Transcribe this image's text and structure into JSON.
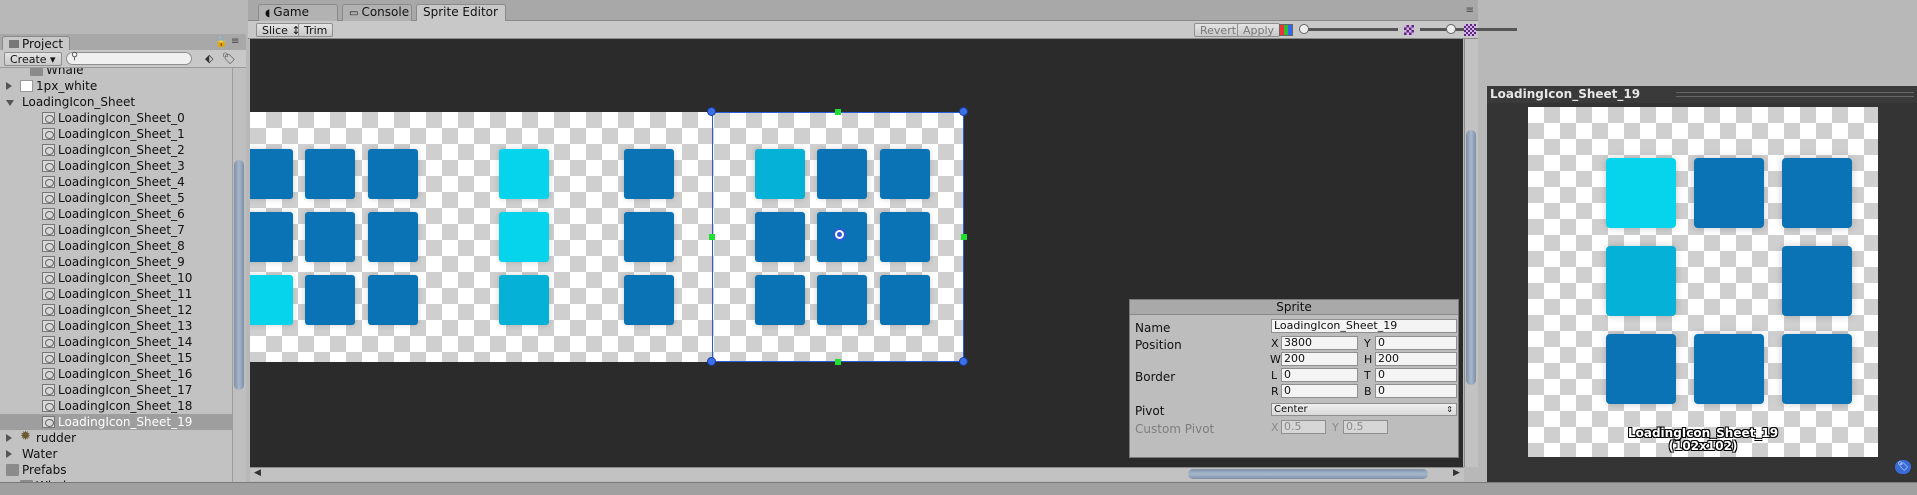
{
  "project": {
    "tab_label": "Project",
    "create_label": "Create ▾",
    "items": [
      {
        "label": "Whale",
        "icon": "folder-icon"
      },
      {
        "label": "1px_white",
        "icon": "white-texture-icon",
        "expand": "collapsed"
      },
      {
        "label": "LoadingIcon_Sheet",
        "icon": "none",
        "expand": "expanded"
      },
      {
        "label": "LoadingIcon_Sheet_0",
        "icon": "sprite-icon"
      },
      {
        "label": "LoadingIcon_Sheet_1",
        "icon": "sprite-icon"
      },
      {
        "label": "LoadingIcon_Sheet_2",
        "icon": "sprite-icon"
      },
      {
        "label": "LoadingIcon_Sheet_3",
        "icon": "sprite-icon"
      },
      {
        "label": "LoadingIcon_Sheet_4",
        "icon": "sprite-icon"
      },
      {
        "label": "LoadingIcon_Sheet_5",
        "icon": "sprite-icon"
      },
      {
        "label": "LoadingIcon_Sheet_6",
        "icon": "sprite-icon"
      },
      {
        "label": "LoadingIcon_Sheet_7",
        "icon": "sprite-icon"
      },
      {
        "label": "LoadingIcon_Sheet_8",
        "icon": "sprite-icon"
      },
      {
        "label": "LoadingIcon_Sheet_9",
        "icon": "sprite-icon"
      },
      {
        "label": "LoadingIcon_Sheet_10",
        "icon": "sprite-icon"
      },
      {
        "label": "LoadingIcon_Sheet_11",
        "icon": "sprite-icon"
      },
      {
        "label": "LoadingIcon_Sheet_12",
        "icon": "sprite-icon"
      },
      {
        "label": "LoadingIcon_Sheet_13",
        "icon": "sprite-icon"
      },
      {
        "label": "LoadingIcon_Sheet_14",
        "icon": "sprite-icon"
      },
      {
        "label": "LoadingIcon_Sheet_15",
        "icon": "sprite-icon"
      },
      {
        "label": "LoadingIcon_Sheet_16",
        "icon": "sprite-icon"
      },
      {
        "label": "LoadingIcon_Sheet_17",
        "icon": "sprite-icon"
      },
      {
        "label": "LoadingIcon_Sheet_18",
        "icon": "sprite-icon"
      },
      {
        "label": "LoadingIcon_Sheet_19",
        "icon": "sprite-icon",
        "selected": true
      },
      {
        "label": "rudder",
        "icon": "gear-icon",
        "expand": "collapsed"
      },
      {
        "label": "Water",
        "icon": "none",
        "expand": "collapsed"
      },
      {
        "label": "Prefabs",
        "icon": "folder-icon",
        "expand": "expanded"
      },
      {
        "label": "Whales",
        "icon": "folder-icon"
      }
    ]
  },
  "tabs": [
    {
      "label": "Game",
      "icon": "game-icon"
    },
    {
      "label": "Console",
      "icon": "console-icon"
    },
    {
      "label": "Sprite Editor",
      "icon": "none",
      "active": true
    }
  ],
  "toolbar": {
    "slice_label": "Slice ↕",
    "trim_label": "Trim",
    "revert_label": "Revert",
    "apply_label": "Apply"
  },
  "sheet": {
    "frames": [
      [
        "d",
        "d",
        "d",
        "c",
        "n",
        "d",
        "m",
        "d",
        "d"
      ],
      [
        "d",
        "d",
        "d",
        "c",
        "n",
        "d",
        "d",
        "d",
        "d"
      ],
      [
        "c",
        "d",
        "d",
        "m",
        "n",
        "d",
        "d",
        "d",
        "d"
      ]
    ]
  },
  "sprite_panel": {
    "title": "Sprite",
    "name_label": "Name",
    "name_value": "LoadingIcon_Sheet_19",
    "position_label": "Position",
    "x_label": "X",
    "x_value": "3800",
    "y_label": "Y",
    "y_value": "0",
    "w_label": "W",
    "w_value": "200",
    "h_label": "H",
    "h_value": "200",
    "border_label": "Border",
    "l_label": "L",
    "l_value": "0",
    "t_label": "T",
    "t_value": "0",
    "r_label": "R",
    "r_value": "0",
    "b_label": "B",
    "b_value": "0",
    "pivot_label": "Pivot",
    "pivot_value": "Center",
    "custom_pivot_label": "Custom Pivot",
    "cx_label": "X",
    "cx_value": "0.5",
    "cy_label": "Y",
    "cy_value": "0.5"
  },
  "preview": {
    "title": "LoadingIcon_Sheet_19",
    "caption_name": "LoadingIcon_Sheet_19",
    "caption_size": "(102x102)",
    "grid": [
      "c",
      "d",
      "d",
      "m",
      "n",
      "d",
      "d",
      "d",
      "d"
    ]
  },
  "colors": {
    "dark_blue": "#0a73b5",
    "cyan": "#05d4ec",
    "mid_cyan": "#06b1d8",
    "selection": "#2d5bd6"
  }
}
